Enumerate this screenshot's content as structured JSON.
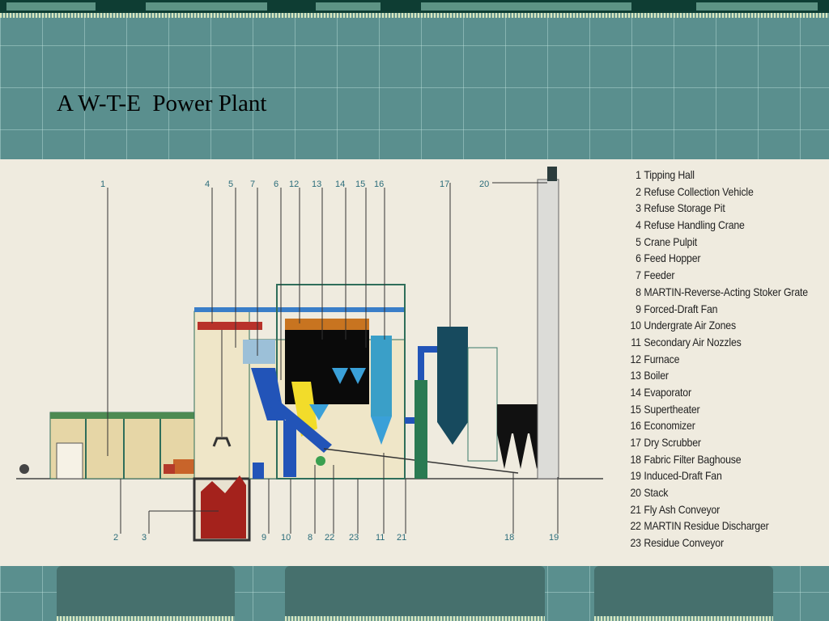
{
  "slide": {
    "title": "A W-T-E  Power Plant"
  },
  "diagram": {
    "callouts_top": [
      "1",
      "4",
      "5",
      "7",
      "6",
      "12",
      "13",
      "14",
      "15",
      "16",
      "17",
      "20"
    ],
    "callouts_bottom": [
      "2",
      "3",
      "9",
      "10",
      "8",
      "22",
      "23",
      "11",
      "21",
      "18",
      "19"
    ],
    "legend": [
      {
        "num": "1",
        "label": "Tipping Hall"
      },
      {
        "num": "2",
        "label": "Refuse Collection Vehicle"
      },
      {
        "num": "3",
        "label": "Refuse Storage Pit"
      },
      {
        "num": "4",
        "label": "Refuse Handling Crane"
      },
      {
        "num": "5",
        "label": "Crane Pulpit"
      },
      {
        "num": "6",
        "label": "Feed Hopper"
      },
      {
        "num": "7",
        "label": "Feeder"
      },
      {
        "num": "8",
        "label": "MARTIN-Reverse-Acting Stoker Grate"
      },
      {
        "num": "9",
        "label": "Forced-Draft Fan"
      },
      {
        "num": "10",
        "label": "Undergrate Air Zones"
      },
      {
        "num": "11",
        "label": "Secondary Air Nozzles"
      },
      {
        "num": "12",
        "label": "Furnace"
      },
      {
        "num": "13",
        "label": "Boiler"
      },
      {
        "num": "14",
        "label": "Evaporator"
      },
      {
        "num": "15",
        "label": "Supertheater"
      },
      {
        "num": "16",
        "label": "Economizer"
      },
      {
        "num": "17",
        "label": "Dry Scrubber"
      },
      {
        "num": "18",
        "label": "Fabric Filter Baghouse"
      },
      {
        "num": "19",
        "label": "Induced-Draft Fan"
      },
      {
        "num": "20",
        "label": "Stack"
      },
      {
        "num": "21",
        "label": "Fly Ash Conveyor"
      },
      {
        "num": "22",
        "label": "MARTIN Residue Discharger"
      },
      {
        "num": "23",
        "label": "Residue Conveyor"
      }
    ]
  }
}
